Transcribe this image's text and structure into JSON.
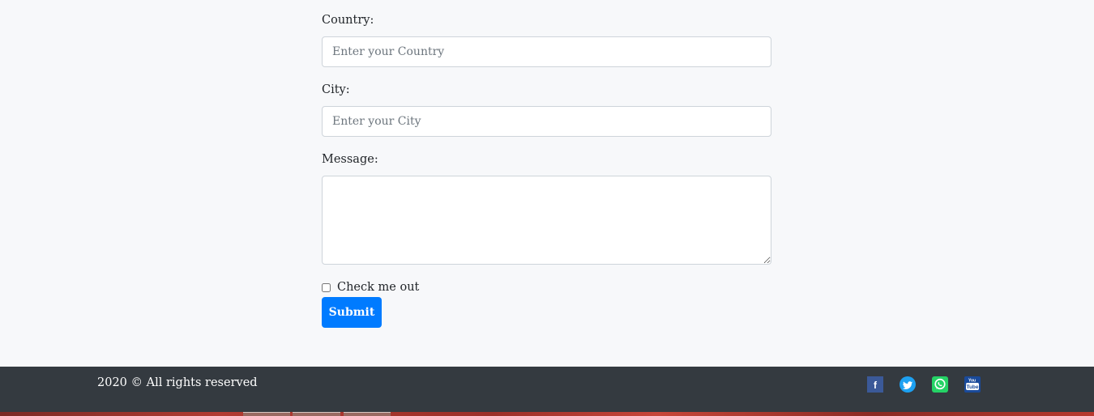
{
  "form": {
    "country": {
      "label": "Country:",
      "placeholder": "Enter your Country",
      "value": ""
    },
    "city": {
      "label": "City:",
      "placeholder": "Enter your City",
      "value": ""
    },
    "message": {
      "label": "Message:",
      "value": ""
    },
    "checkbox": {
      "label": "Check me out",
      "checked": false
    },
    "submit_label": "Submit"
  },
  "footer": {
    "copyright": "2020 © All rights reserved",
    "social": [
      {
        "icon": "facebook-icon",
        "color": "#3b5998"
      },
      {
        "icon": "twitter-icon",
        "color": "#1da1f2"
      },
      {
        "icon": "whatsapp-icon",
        "color": "#25d366"
      },
      {
        "icon": "youtube-icon",
        "color": "#1a4a9a"
      }
    ]
  },
  "colors": {
    "background": "#f7f8fa",
    "footer_bg": "#343a40",
    "primary_button": "#007bff",
    "input_border": "#ced4da"
  }
}
